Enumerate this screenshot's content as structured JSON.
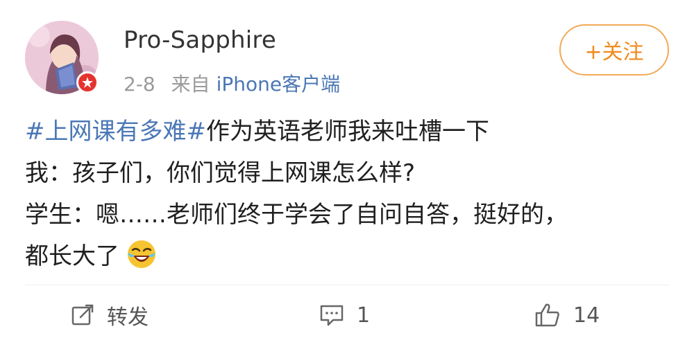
{
  "post": {
    "author": "Pro-Sapphire",
    "date": "2-8",
    "source_prefix": "来自",
    "source": "iPhone客户端",
    "follow_label": "+关注",
    "hashtag": "#上网课有多难#",
    "line1_rest": "作为英语老师我来吐槽一下",
    "line2": "我：孩子们，你们觉得上网课怎么样?",
    "line3": "学生：嗯……老师们终于学会了自问自答，挺好的，",
    "line4": "都长大了",
    "emoji": "laughing-crying-emoji"
  },
  "actions": {
    "repost_label": "转发",
    "comment_count": "1",
    "like_count": "14"
  },
  "colors": {
    "link": "#4a77b5",
    "follow": "#f08a1e",
    "follow_border": "#f3a957",
    "verified_badge": "#e5322d",
    "meta": "#9a9a9a"
  }
}
